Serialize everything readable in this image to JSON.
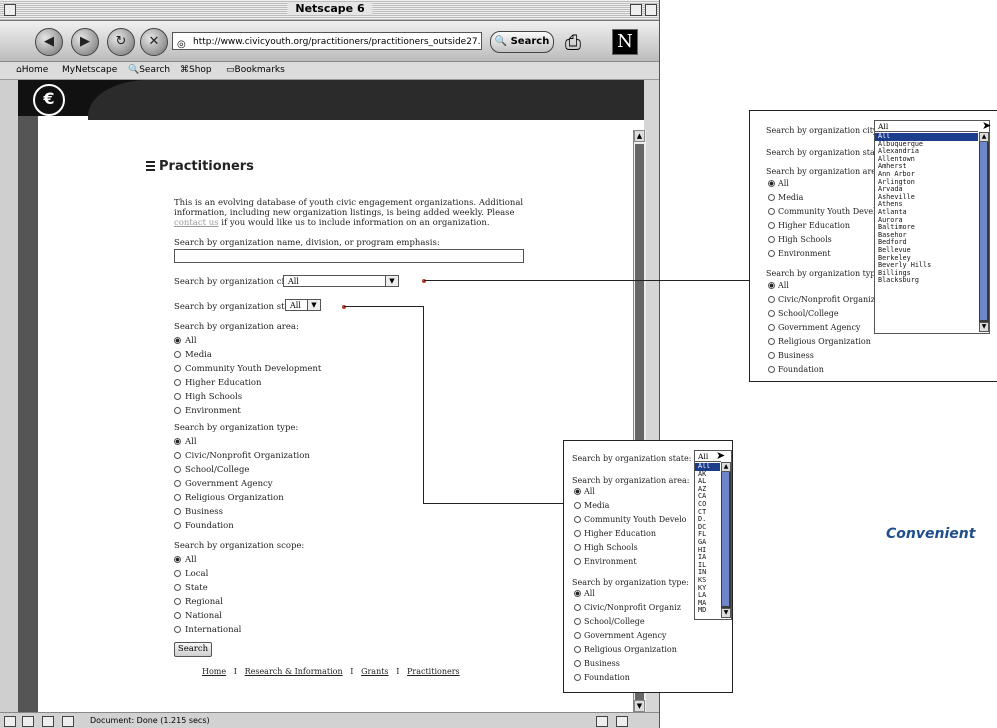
{
  "browser": {
    "window_title": "Netscape 6",
    "url": "http://www.civicyouth.org/practitioners/practitioners_outside27.htm",
    "search_label": "Search",
    "personal_toolbar": {
      "home": "Home",
      "my_netscape": "Netscape",
      "search": "Search",
      "shop": "Shop",
      "bookmarks": "Bookmarks"
    },
    "status": "Document: Done (1.215 secs)"
  },
  "page": {
    "title": "Practitioners",
    "intro_before_link": "This is an evolving database of youth civic engagement organizations. Additional information, including new organization listings, is being added weekly. Please ",
    "intro_link": "contact us",
    "intro_after_link": " if you would like us to include information on an organization.",
    "name_search_label": "Search by organization name, division, or program emphasis:",
    "name_search_value": "",
    "city_label": "Search by organization city:",
    "city_value": "All",
    "state_label": "Search by organization state:",
    "state_value": "All",
    "area_label": "Search by organization area:",
    "area_options": [
      "All",
      "Media",
      "Community Youth Development",
      "Higher Education",
      "High Schools",
      "Environment"
    ],
    "type_label": "Search by organization type:",
    "type_options": [
      "All",
      "Civic/Nonprofit Organization",
      "School/College",
      "Government Agency",
      "Religious Organization",
      "Business",
      "Foundation"
    ],
    "scope_label": "Search by organization scope:",
    "scope_options": [
      "All",
      "Local",
      "State",
      "Regional",
      "National",
      "International"
    ],
    "search_button": "Search",
    "footer": {
      "home": "Home",
      "research": "Research & Information",
      "grants": "Grants",
      "practitioners": "Practitioners",
      "sep": "I"
    }
  },
  "callout_city": {
    "city_label": "Search by organization city:",
    "city_value": "All",
    "state_label": "Search by organization state:",
    "area_label": "Search by organization area:",
    "area_options": [
      "All",
      "Media",
      "Community Youth Develo",
      "Higher Education",
      "High Schools",
      "Environment"
    ],
    "type_label": "Search by organization type:",
    "type_options": [
      "All",
      "Civic/Nonprofit Organiz",
      "School/College",
      "Government Agency",
      "Religious Organization",
      "Business",
      "Foundation"
    ],
    "city_list": [
      "All",
      "Albuquerque",
      "Alexandria",
      "Allentown",
      "Amherst",
      "Ann Arbor",
      "Arlington",
      "Arvada",
      "Asheville",
      "Athens",
      "Atlanta",
      "Aurora",
      "Baltimore",
      "Basehor",
      "Bedford",
      "Bellevue",
      "Berkeley",
      "Beverly Hills",
      "Billings",
      "Blacksburg"
    ]
  },
  "callout_state": {
    "state_label": "Search by organization state:",
    "state_value": "All",
    "area_label": "Search by organization area:",
    "area_options": [
      "All",
      "Media",
      "Community Youth Develo",
      "Higher Education",
      "High Schools",
      "Environment"
    ],
    "type_label": "Search by organization type:",
    "type_options": [
      "All",
      "Civic/Nonprofit Organiz",
      "School/College",
      "Government Agency",
      "Religious Organization",
      "Business",
      "Foundation"
    ],
    "state_list": [
      "All",
      "AK",
      "AL",
      "AZ",
      "CA",
      "CO",
      "CT",
      "D.",
      "DC",
      "FL",
      "GA",
      "HI",
      "IA",
      "IL",
      "IN",
      "KS",
      "KY",
      "LA",
      "MA",
      "MD"
    ]
  },
  "caption": "Convenient",
  "colors": {
    "selection": "#1c3c8c",
    "caption": "#1f4e8c",
    "connector_dot": "#c0392b"
  }
}
